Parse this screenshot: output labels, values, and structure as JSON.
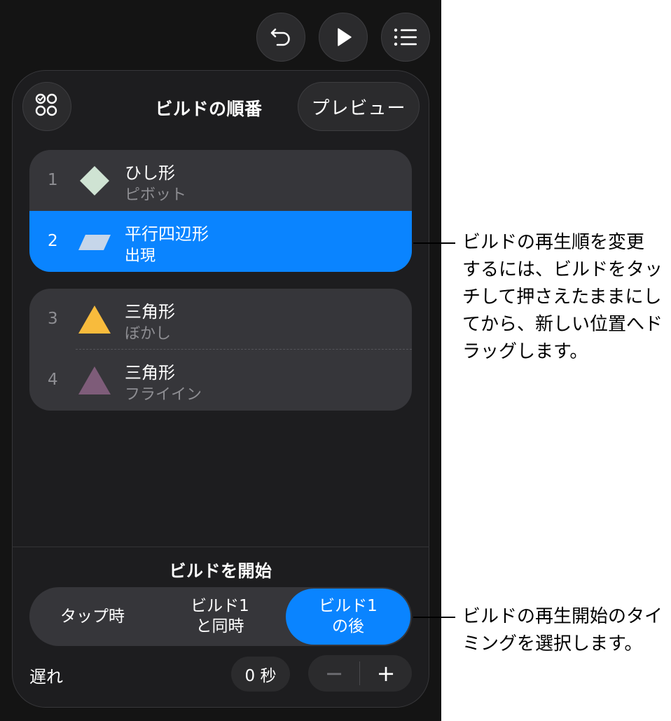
{
  "toolbar": {
    "undo_icon": "undo-arrow-icon",
    "play_icon": "play-icon",
    "list_icon": "list-icon"
  },
  "panel": {
    "title": "ビルドの順番",
    "preview_label": "プレビュー",
    "builds_icon": "build-order-icon"
  },
  "builds": [
    {
      "number": "1",
      "name": "ひし形",
      "effect": "ピボット",
      "shape": "diamond",
      "color": "#cfe3d3"
    },
    {
      "number": "2",
      "name": "平行四辺形",
      "effect": "出現",
      "shape": "parallelogram",
      "color": "#c6d6ea",
      "selected": true
    },
    {
      "number": "3",
      "name": "三角形",
      "effect": "ぼかし",
      "shape": "triangle",
      "color": "#f8bb3c"
    },
    {
      "number": "4",
      "name": "三角形",
      "effect": "フライイン",
      "shape": "triangle",
      "color": "#7e5c79"
    }
  ],
  "start": {
    "title": "ビルドを開始",
    "options": [
      {
        "line1": "タップ時",
        "line2": ""
      },
      {
        "line1": "ビルド1",
        "line2": "と同時"
      },
      {
        "line1": "ビルド1",
        "line2": "の後"
      }
    ],
    "selected_index": 2
  },
  "delay": {
    "label": "遅れ",
    "value": "0 秒",
    "minus": "−",
    "plus": "+"
  },
  "callouts": {
    "order": [
      "ビルドの再生順を変更",
      "するには、ビルドをタッ",
      "チして押さえたままにし",
      "てから、新しい位置へド",
      "ラッグします。"
    ],
    "timing": [
      "ビルドの再生開始のタイ",
      "ミングを選択します。"
    ]
  },
  "colors": {
    "accent": "#0a84ff",
    "background": "#141414",
    "panel": "#1d1d1f",
    "row": "#36363a"
  }
}
